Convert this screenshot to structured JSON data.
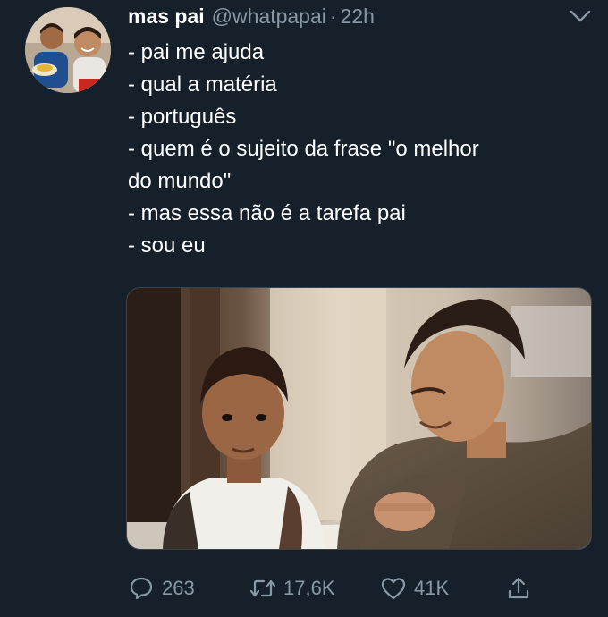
{
  "tweet": {
    "author_name": "mas pai",
    "handle": "@whatpapai",
    "separator": "·",
    "time": "22h",
    "lines": [
      "- pai me ajuda",
      "- qual a matéria",
      "- português",
      "- quem é o sujeito da frase \"o melhor",
      "do mundo\"",
      "- mas essa não é a tarefa pai",
      "- sou eu"
    ],
    "actions": {
      "replies": "263",
      "retweets": "17,6K",
      "likes": "41K"
    }
  },
  "colors": {
    "background": "#15202b",
    "secondary_text": "#8899a6",
    "primary_text": "#ffffff"
  }
}
